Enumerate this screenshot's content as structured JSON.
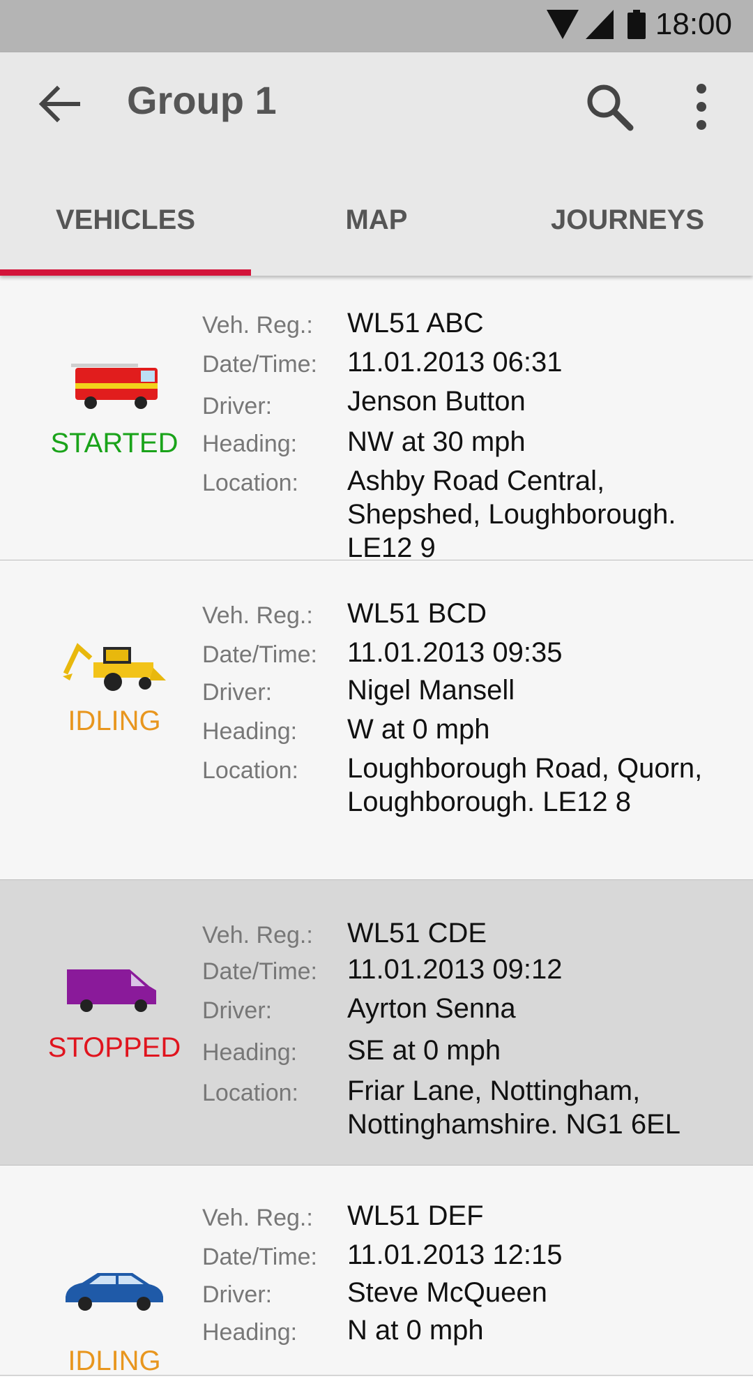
{
  "status_bar": {
    "time": "18:00"
  },
  "app_bar": {
    "title": "Group 1"
  },
  "tabs": [
    {
      "label": "VEHICLES",
      "selected": true
    },
    {
      "label": "MAP",
      "selected": false
    },
    {
      "label": "JOURNEYS",
      "selected": false
    }
  ],
  "colors": {
    "accent": "#d3143a",
    "started": "#1aa31a",
    "idling": "#e8961e",
    "stopped": "#e0141e"
  },
  "field_labels": {
    "reg": "Veh. Reg.:",
    "datetime": "Date/Time:",
    "driver": "Driver:",
    "heading": "Heading:",
    "location": "Location:"
  },
  "vehicles": [
    {
      "icon": "fire-engine-icon",
      "status": "STARTED",
      "reg": "WL51 ABC",
      "datetime": "11.01.2013  06:31",
      "driver": "Jenson Button",
      "heading": "NW at 30 mph",
      "location": "Ashby Road Central, Shepshed, Loughborough. LE12 9"
    },
    {
      "icon": "backhoe-loader-icon",
      "status": "IDLING",
      "reg": "WL51 BCD",
      "datetime": "11.01.2013  09:35",
      "driver": "Nigel Mansell",
      "heading": "W at 0 mph",
      "location": "Loughborough Road, Quorn, Loughborough. LE12 8"
    },
    {
      "icon": "van-icon",
      "status": "STOPPED",
      "reg": "WL51 CDE",
      "datetime": "11.01.2013  09:12",
      "driver": "Ayrton Senna",
      "heading": "SE at 0 mph",
      "location": "Friar Lane, Nottingham, Nottinghamshire. NG1 6EL"
    },
    {
      "icon": "car-icon",
      "status": "IDLING",
      "reg": "WL51 DEF",
      "datetime": "11.01.2013  12:15",
      "driver": "Steve McQueen",
      "heading": "N at 0 mph",
      "location": ""
    }
  ]
}
